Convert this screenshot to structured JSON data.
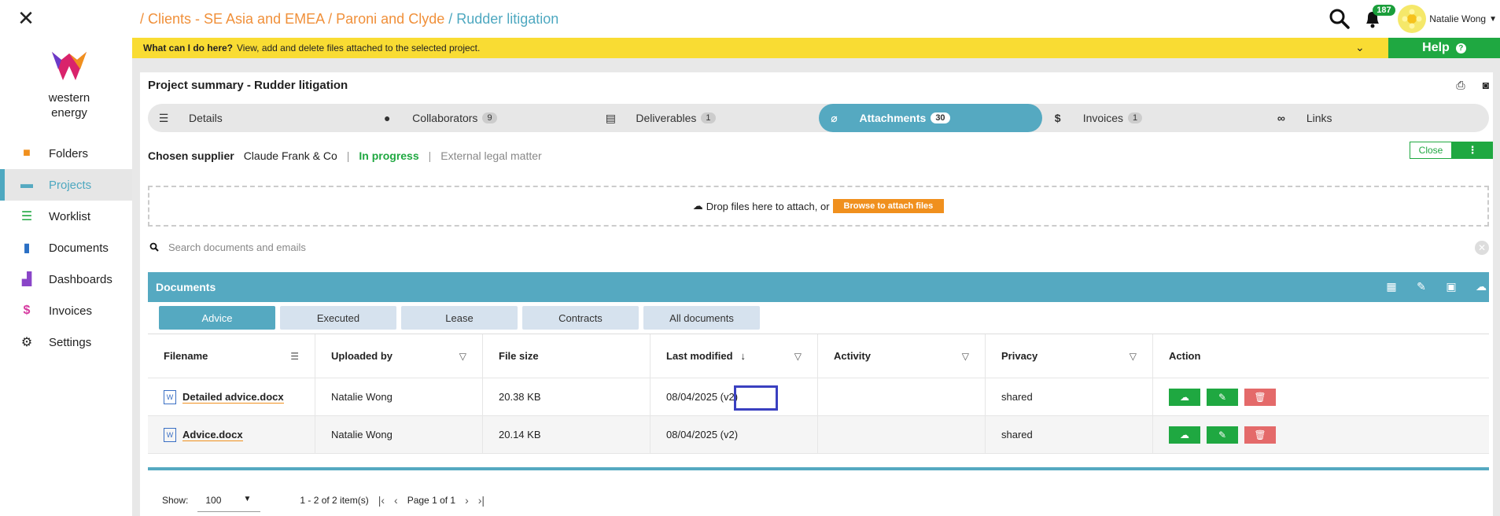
{
  "breadcrumb": {
    "items": [
      "/ Clients - SE Asia and EMEA",
      "/ Paroni and Clyde",
      "/ Rudder litigation"
    ]
  },
  "header": {
    "notification_count": "187",
    "user_name": "Natalie Wong"
  },
  "logo": {
    "line1": "western",
    "line2": "energy"
  },
  "sidebar": {
    "items": [
      {
        "label": "Folders",
        "icon": "folder-icon",
        "color": "#f0901e"
      },
      {
        "label": "Projects",
        "icon": "briefcase-icon",
        "color": "#55a9c1"
      },
      {
        "label": "Worklist",
        "icon": "worklist-icon",
        "color": "#1fa841"
      },
      {
        "label": "Documents",
        "icon": "document-icon",
        "color": "#2a6fc4"
      },
      {
        "label": "Dashboards",
        "icon": "bar-chart-icon",
        "color": "#8a45c8"
      },
      {
        "label": "Invoices",
        "icon": "dollar-icon",
        "color": "#d63aa0"
      },
      {
        "label": "Settings",
        "icon": "gear-icon",
        "color": "#222222"
      }
    ]
  },
  "banner": {
    "question": "What can I do here?",
    "text": "View, add and delete files attached to the selected project.",
    "help_label": "Help"
  },
  "panel": {
    "title": "Project summary - Rudder litigation"
  },
  "tabs": [
    {
      "label": "Details",
      "count": ""
    },
    {
      "label": "Collaborators",
      "count": "9"
    },
    {
      "label": "Deliverables",
      "count": "1"
    },
    {
      "label": "Attachments",
      "count": "30"
    },
    {
      "label": "Invoices",
      "count": "1"
    },
    {
      "label": "Links",
      "count": ""
    }
  ],
  "supplier": {
    "label": "Chosen supplier",
    "name": "Claude Frank & Co",
    "status": "In progress",
    "matter": "External legal matter",
    "close_label": "Close"
  },
  "dropzone": {
    "text": "Drop files here to attach, or",
    "browse_label": "Browse to attach files"
  },
  "search": {
    "placeholder": "Search documents and emails"
  },
  "documents": {
    "title": "Documents",
    "subtabs": [
      "Advice",
      "Executed",
      "Lease",
      "Contracts",
      "All documents"
    ],
    "columns": [
      "Filename",
      "Uploaded by",
      "File size",
      "Last modified",
      "Activity",
      "Privacy",
      "Action"
    ],
    "rows": [
      {
        "filename": "Detailed advice.docx",
        "uploaded_by": "Natalie Wong",
        "size": "20.38 KB",
        "modified": "08/04/2025 (v2)",
        "activity": "",
        "privacy": "shared"
      },
      {
        "filename": "Advice.docx",
        "uploaded_by": "Natalie Wong",
        "size": "20.14 KB",
        "modified": "08/04/2025 (v2)",
        "activity": "",
        "privacy": "shared"
      }
    ]
  },
  "pager": {
    "show_label": "Show:",
    "page_size": "100",
    "range": "1 - 2 of 2 item(s)",
    "page_label": "Page 1 of 1"
  }
}
